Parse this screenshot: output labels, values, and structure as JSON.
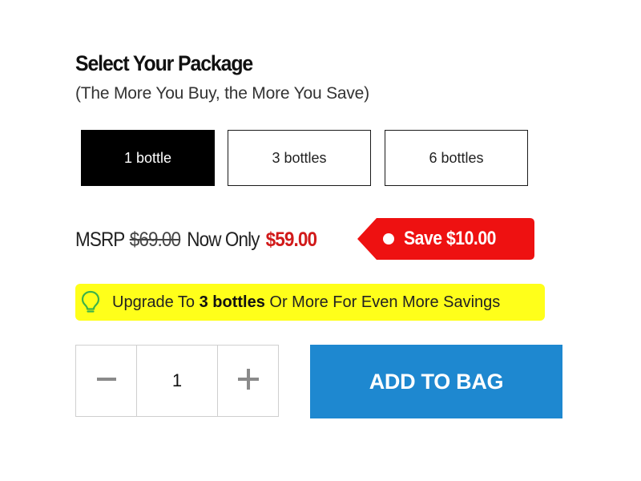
{
  "header": {
    "title": "Select Your Package",
    "subtitle": "(The More You Buy, the More You Save)"
  },
  "packages": [
    {
      "label": "1 bottle",
      "selected": true
    },
    {
      "label": "3 bottles",
      "selected": false
    },
    {
      "label": "6 bottles",
      "selected": false
    }
  ],
  "pricing": {
    "msrp_label": "MSRP",
    "msrp_price": "$69.00",
    "now_label": "Now Only",
    "now_price": "$59.00",
    "save_label": "Save $10.00"
  },
  "tip": {
    "icon": "lightbulb-icon",
    "prefix": "Upgrade To ",
    "highlight": "3 bottles",
    "suffix": " Or More For Even More Savings"
  },
  "quantity": {
    "minus_icon": "minus-icon",
    "value": "1",
    "plus_icon": "plus-icon"
  },
  "cart": {
    "add_label": "ADD TO BAG"
  },
  "colors": {
    "selected_package_bg": "#000000",
    "price_red": "#d11a1a",
    "save_tag_red": "#ee1111",
    "tip_yellow": "#ffff1a",
    "add_button_blue": "#1e88d0"
  }
}
